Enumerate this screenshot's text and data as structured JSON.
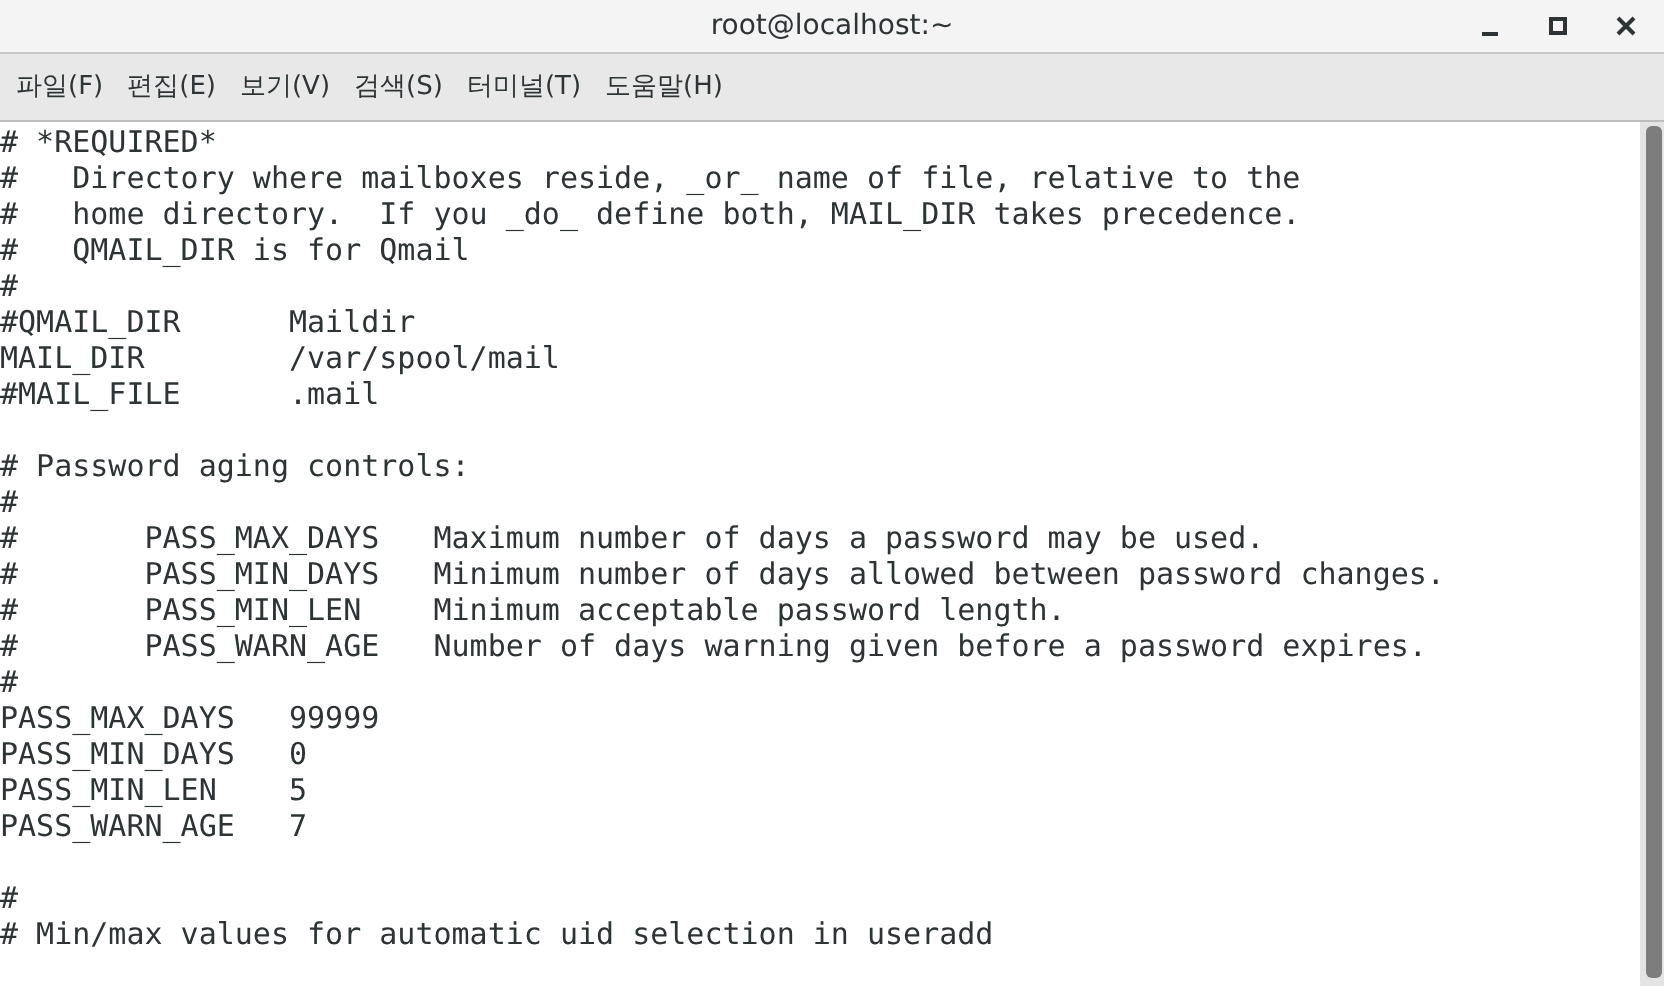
{
  "window": {
    "title": "root@localhost:~"
  },
  "menu": [
    "파일(F)",
    "편집(E)",
    "보기(V)",
    "검색(S)",
    "터미널(T)",
    "도움말(H)"
  ],
  "terminal": {
    "lines": [
      {
        "kind": "text",
        "text": "# *REQUIRED*"
      },
      {
        "kind": "text",
        "text": "#   Directory where mailboxes reside, _or_ name of file, relative to the"
      },
      {
        "kind": "text",
        "text": "#   home directory.  If you _do_ define both, MAIL_DIR takes precedence."
      },
      {
        "kind": "text",
        "text": "#   QMAIL_DIR is for Qmail"
      },
      {
        "kind": "text",
        "text": "#"
      },
      {
        "kind": "text",
        "text": "#QMAIL_DIR      Maildir"
      },
      {
        "kind": "text",
        "text": "MAIL_DIR        /var/spool/mail"
      },
      {
        "kind": "text",
        "text": "#MAIL_FILE      .mail"
      },
      {
        "kind": "blank"
      },
      {
        "kind": "text",
        "text": "# Password aging controls:"
      },
      {
        "kind": "text",
        "text": "#"
      },
      {
        "kind": "text",
        "text": "#       PASS_MAX_DAYS   Maximum number of days a password may be used."
      },
      {
        "kind": "text",
        "text": "#       PASS_MIN_DAYS   Minimum number of days allowed between password changes."
      },
      {
        "kind": "text",
        "text": "#       PASS_MIN_LEN    Minimum acceptable password length."
      },
      {
        "kind": "text",
        "text": "#       PASS_WARN_AGE   Number of days warning given before a password expires."
      },
      {
        "kind": "text",
        "text": "#"
      },
      {
        "kind": "text",
        "text": "PASS_MAX_DAYS   99999"
      },
      {
        "kind": "text",
        "text": "PASS_MIN_DAYS   0"
      },
      {
        "kind": "text",
        "text": "PASS_MIN_LEN    5"
      },
      {
        "kind": "text",
        "text": "PASS_WARN_AGE   7"
      },
      {
        "kind": "blank"
      },
      {
        "kind": "text",
        "text": "#"
      },
      {
        "kind": "text",
        "text": "# Min/max values for automatic uid selection in useradd"
      }
    ]
  }
}
